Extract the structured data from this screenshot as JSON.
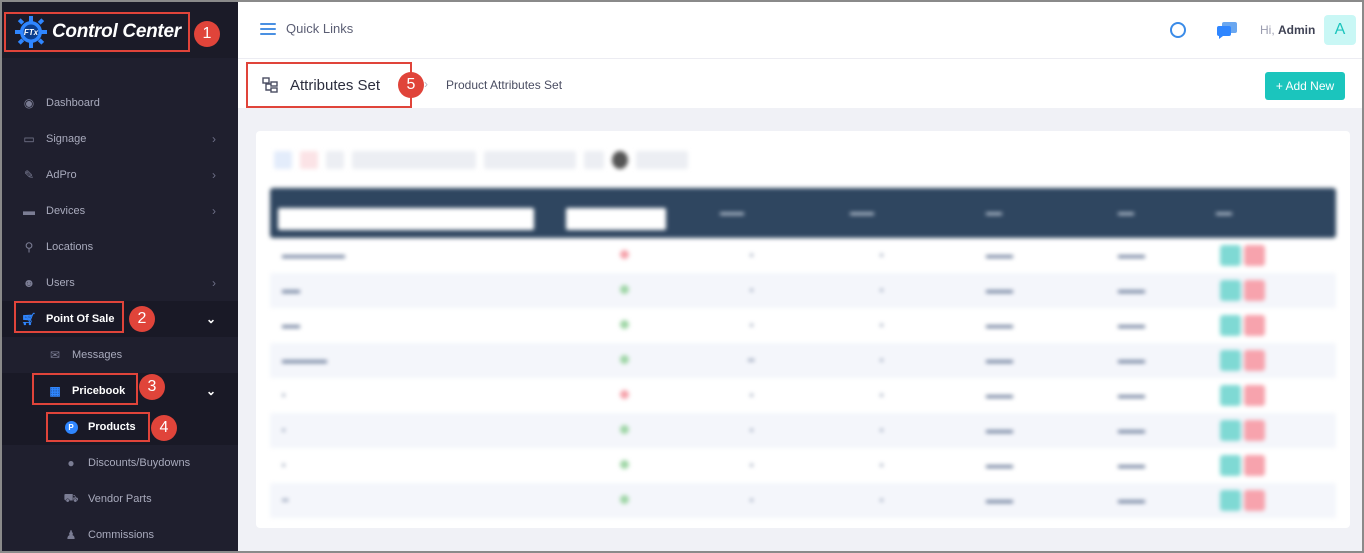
{
  "brand": {
    "name": "Control Center",
    "logo_text": "FTx"
  },
  "callouts": [
    "1",
    "2",
    "3",
    "4",
    "5"
  ],
  "sidebar": {
    "items": [
      {
        "label": "Dashboard",
        "icon": "dashboard-icon"
      },
      {
        "label": "Signage",
        "icon": "monitor-icon",
        "chevron": "›"
      },
      {
        "label": "AdPro",
        "icon": "brush-icon",
        "chevron": "›"
      },
      {
        "label": "Devices",
        "icon": "devices-icon",
        "chevron": "›"
      },
      {
        "label": "Locations",
        "icon": "location-pin-icon"
      },
      {
        "label": "Users",
        "icon": "users-icon",
        "chevron": "›"
      },
      {
        "label": "Point Of Sale",
        "icon": "cart-icon",
        "chevron": "⌄"
      },
      {
        "label": "Messages",
        "icon": "message-icon"
      },
      {
        "label": "Pricebook",
        "icon": "calculator-icon",
        "chevron": "⌄"
      },
      {
        "label": "Products",
        "icon": "p-circle-icon"
      },
      {
        "label": "Discounts/Buydowns",
        "icon": "discount-icon"
      },
      {
        "label": "Vendor Parts",
        "icon": "vendor-icon"
      },
      {
        "label": "Commissions",
        "icon": "money-bag-icon"
      }
    ]
  },
  "topbar": {
    "quick_links": "Quick Links",
    "greeting": "Hi,",
    "user": "Admin",
    "avatar_letter": "A"
  },
  "subheader": {
    "title": "Attributes Set",
    "breadcrumb": "Product Attributes Set",
    "add_button": "+ Add New"
  },
  "colors": {
    "accent": "#1bc5bd",
    "highlight": "#e0443a",
    "sidebar_bg": "#1f1f2e",
    "table_header": "#2f4660"
  }
}
